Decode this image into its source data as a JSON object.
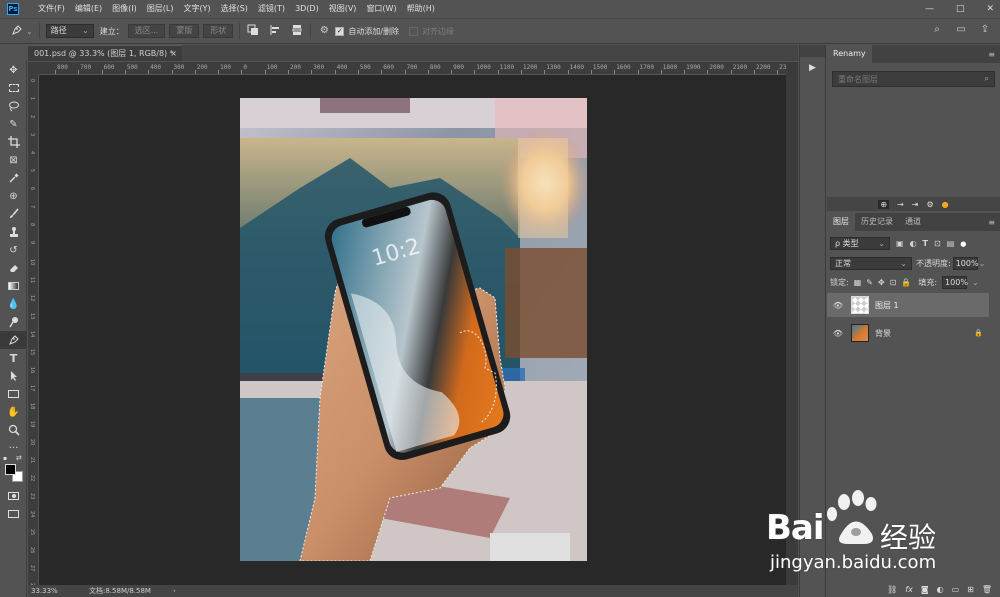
{
  "menubar": {
    "app_icon": "Ps",
    "items": [
      "文件(F)",
      "编辑(E)",
      "图像(I)",
      "图层(L)",
      "文字(Y)",
      "选择(S)",
      "滤镜(T)",
      "3D(D)",
      "视图(V)",
      "窗口(W)",
      "帮助(H)"
    ],
    "window_buttons": [
      "—",
      "□",
      "✕"
    ]
  },
  "options": {
    "tool_icon": "pen-icon",
    "mode_value": "路径",
    "make_label": "建立：",
    "selection_btn": "选区...",
    "mask_btn": "蒙版",
    "shape_btn": "形状",
    "auto_add_delete": "自动添加/删除",
    "align_edges": "对齐边缘"
  },
  "document": {
    "tab_title": "001.psd @ 33.3% (图层 1, RGB/8) *",
    "close": "×"
  },
  "ruler_h_labels": [
    "800",
    "700",
    "600",
    "500",
    "400",
    "300",
    "200",
    "100",
    "0",
    "100",
    "200",
    "300",
    "400",
    "500",
    "600",
    "700",
    "800",
    "900",
    "1000",
    "1100",
    "1200",
    "1300",
    "1400",
    "1500",
    "1600",
    "1700",
    "1800",
    "1900",
    "2000",
    "2100",
    "2200",
    "2300"
  ],
  "ruler_v_labels": [
    "0",
    "1",
    "2",
    "3",
    "4",
    "5",
    "6",
    "7",
    "8",
    "9",
    "10",
    "11",
    "12",
    "13",
    "14",
    "15",
    "16",
    "17",
    "18",
    "19",
    "20",
    "21",
    "22",
    "23",
    "24",
    "25",
    "26",
    "27",
    "28"
  ],
  "status": {
    "zoom": "33.33%",
    "doc_size": "文档:8.58M/8.58M",
    "arrow": "›"
  },
  "renamy": {
    "title": "Renamy",
    "placeholder": "重命名图层"
  },
  "layers_panel": {
    "tabs": [
      "图层",
      "历史记录",
      "通道"
    ],
    "filter_label": "ρ 类型",
    "blend_mode": "正常",
    "opacity_label": "不透明度:",
    "opacity_value": "100%",
    "lock_label": "锁定:",
    "fill_label": "填充:",
    "fill_value": "100%",
    "layers": [
      {
        "name": "图层 1",
        "selected": true
      },
      {
        "name": "背景",
        "locked": true
      }
    ],
    "footer_icons": [
      "link-icon",
      "fx",
      "mask-icon",
      "adjustment-icon",
      "group-icon",
      "new-layer-icon",
      "trash-icon"
    ]
  },
  "watermark": {
    "brand": "Bai",
    "brand2": "经验",
    "url": "jingyan.baidu.com"
  }
}
